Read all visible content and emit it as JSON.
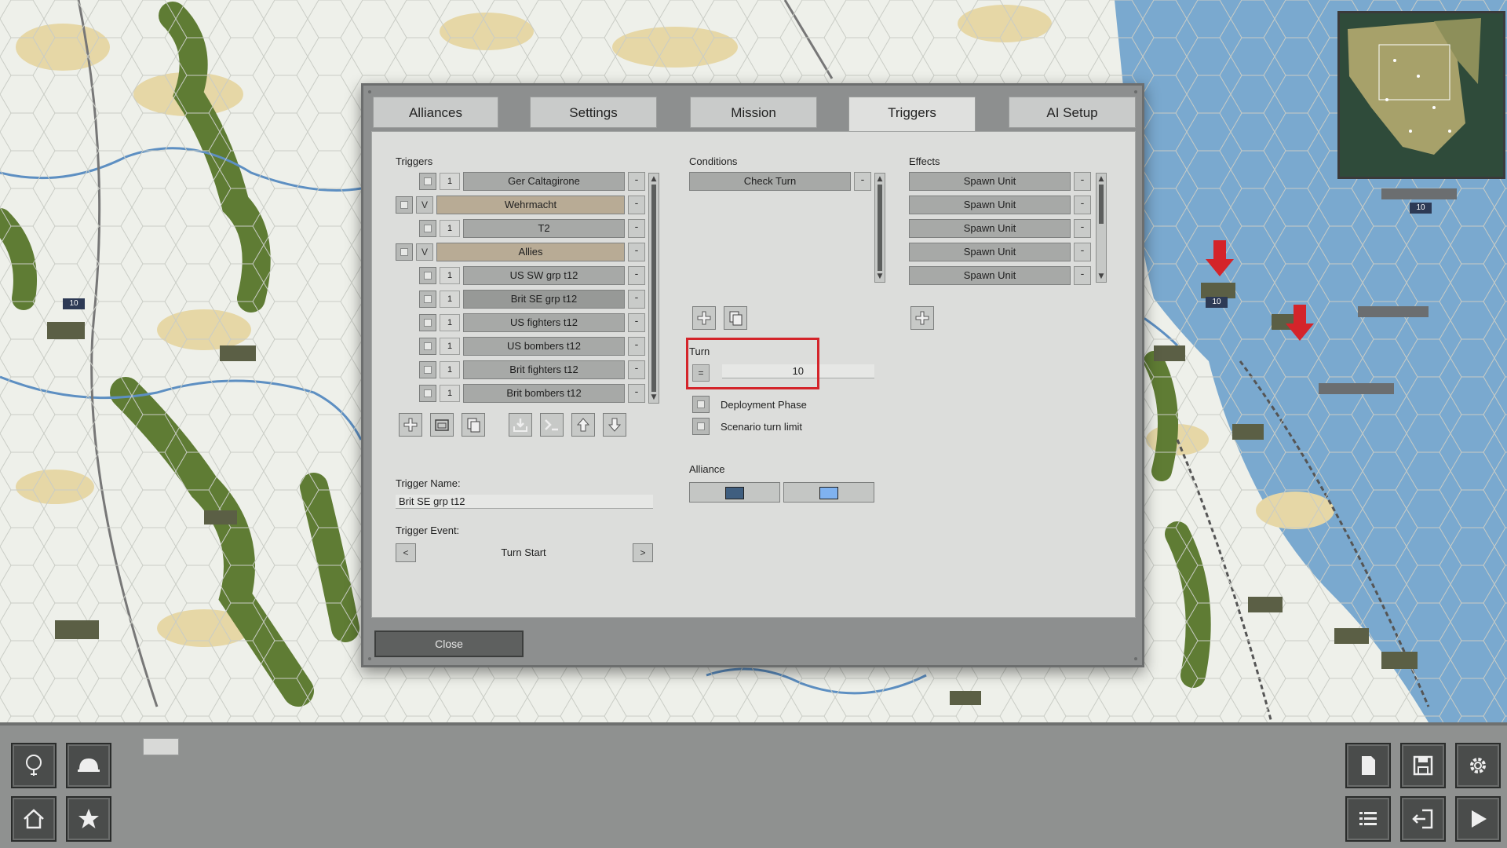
{
  "dialog": {
    "tabs": [
      {
        "label": "Alliances"
      },
      {
        "label": "Settings"
      },
      {
        "label": "Mission"
      },
      {
        "label": "Triggers",
        "active": true
      },
      {
        "label": "AI Setup"
      }
    ],
    "triggers": {
      "heading": "Triggers",
      "rows": [
        {
          "number": "1",
          "name": "Ger Caltagirone",
          "group": false
        },
        {
          "v": "V",
          "name": "Wehrmacht",
          "group": true
        },
        {
          "number": "1",
          "name": "T2",
          "group": false
        },
        {
          "v": "V",
          "name": "Allies",
          "group": true
        },
        {
          "number": "1",
          "name": "US SW grp t12",
          "group": false
        },
        {
          "number": "1",
          "name": "Brit SE grp t12",
          "group": false,
          "selected": true
        },
        {
          "number": "1",
          "name": "US fighters t12",
          "group": false
        },
        {
          "number": "1",
          "name": "US bombers t12",
          "group": false
        },
        {
          "number": "1",
          "name": "Brit fighters t12",
          "group": false
        },
        {
          "number": "1",
          "name": "Brit bombers t12",
          "group": false
        }
      ],
      "remove_label": "-",
      "toolbar_icons": [
        "add-icon",
        "folder-icon",
        "copy-icon",
        "import-icon",
        "console-icon",
        "move-up-icon",
        "move-down-icon"
      ],
      "trigger_name_label": "Trigger Name:",
      "trigger_name_value": "Brit SE grp t12",
      "trigger_event_label": "Trigger Event:",
      "trigger_event_value": "Turn Start",
      "prev_label": "<",
      "next_label": ">"
    },
    "conditions": {
      "heading": "Conditions",
      "items": [
        {
          "name": "Check Turn"
        }
      ],
      "remove_label": "-",
      "turn_label": "Turn",
      "turn_operator": "=",
      "turn_value": "10",
      "deployment_phase_label": "Deployment Phase",
      "scenario_turn_limit_label": "Scenario turn limit",
      "alliance_label": "Alliance",
      "alliance_colors": [
        "#3f5e7f",
        "#7fb2f0"
      ]
    },
    "effects": {
      "heading": "Effects",
      "items": [
        {
          "name": "Spawn Unit"
        },
        {
          "name": "Spawn Unit"
        },
        {
          "name": "Spawn Unit"
        },
        {
          "name": "Spawn Unit"
        },
        {
          "name": "Spawn Unit"
        }
      ],
      "remove_label": "-"
    },
    "close_label": "Close"
  },
  "map": {
    "unit_strength": "10",
    "colors": {
      "sea": "#7aa9cf",
      "land": "#eef0ea",
      "forest": "#5f7c34",
      "desert": "#e6d7a6",
      "highlight": "#d4242a"
    }
  },
  "bottombar": {
    "left_icons": [
      "tree-icon",
      "helmet-icon",
      "home-icon",
      "star-icon"
    ],
    "right_icons": [
      "document-icon",
      "save-icon",
      "gear-icon",
      "list-icon",
      "exit-icon",
      "play-icon"
    ]
  }
}
